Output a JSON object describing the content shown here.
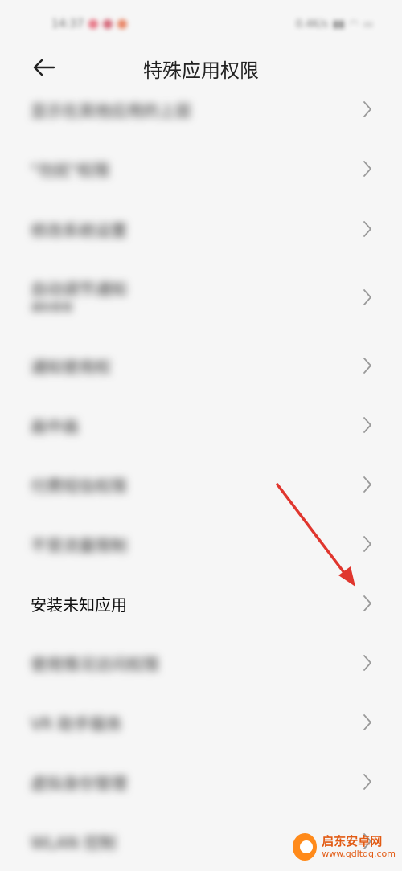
{
  "status_bar": {
    "time": "14:37",
    "right_text": "0.4K/s",
    "dot_colors": [
      "#e1455b",
      "#c8324a",
      "#e2572a"
    ]
  },
  "header": {
    "back_icon": "arrow-left-icon",
    "title": "特殊应用权限"
  },
  "list": {
    "items": [
      {
        "label": "显示在其他应用的上层",
        "blurred": true
      },
      {
        "label": "\"勿扰\"权限",
        "blurred": true
      },
      {
        "label": "修改系统设置",
        "blurred": true
      },
      {
        "label": "自动调节通知",
        "sub": "通知管理",
        "blurred": true
      },
      {
        "label": "通知使用权",
        "blurred": true
      },
      {
        "label": "画中画",
        "blurred": true
      },
      {
        "label": "付费短信权限",
        "blurred": true
      },
      {
        "label": "不受流量限制",
        "blurred": true
      },
      {
        "label": "安装未知应用",
        "blurred": false
      },
      {
        "label": "使用情况访问权限",
        "blurred": true
      },
      {
        "label": "VR 助手服务",
        "blurred": true
      },
      {
        "label": "虚拟身份管理",
        "blurred": true
      },
      {
        "label": "WLAN 控制",
        "blurred": true
      }
    ]
  },
  "annotation": {
    "arrow_color": "#e0362e"
  },
  "watermark": {
    "brand_cn": "启东安卓网",
    "brand_en": "www.qdltdq.com"
  }
}
